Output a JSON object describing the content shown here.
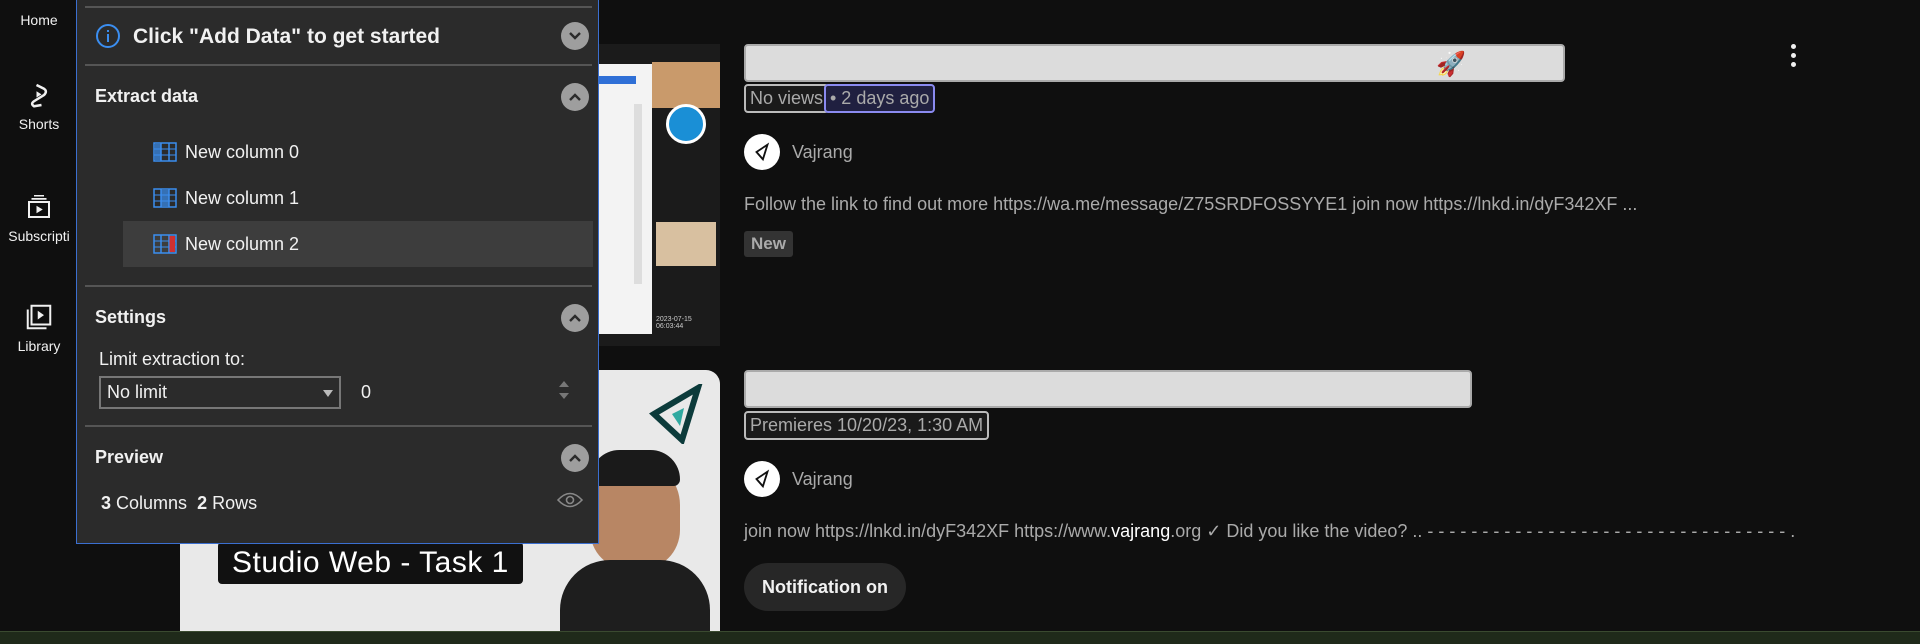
{
  "guide": {
    "items": [
      {
        "label": "Home",
        "icon": "home-icon"
      },
      {
        "label": "Shorts",
        "icon": "shorts-icon"
      },
      {
        "label": "Subscripti",
        "icon": "subscriptions-icon"
      },
      {
        "label": "Library",
        "icon": "library-icon"
      }
    ]
  },
  "panel": {
    "banner": "Click \"Add Data\" to get started",
    "extract_heading": "Extract data",
    "columns": [
      "New column 0",
      "New column 1",
      "New column 2"
    ],
    "settings_heading": "Settings",
    "limit_label": "Limit extraction to:",
    "limit_select": "No limit",
    "limit_value": "0",
    "preview_heading": "Preview",
    "preview_columns_count": "3",
    "preview_columns_label": "Columns",
    "preview_rows_count": "2",
    "preview_rows_label": "Rows"
  },
  "videos": [
    {
      "views": "No views",
      "age": "• 2 days ago",
      "channel": "Vajrang",
      "description": "Follow the link to find out more https://wa.me/message/Z75SRDFOSSYYE1 join now https://lnkd.in/dyF342XF ...",
      "badge": "New",
      "title_emoji": "🚀",
      "thumb_timestamp": "2023-07-15 06:03:44"
    },
    {
      "meta": "Premieres 10/20/23, 1:30 AM",
      "channel": "Vajrang",
      "description_pre": "join now https://lnkd.in/dyF342XF https://www.",
      "description_bold": "vajrang",
      "description_post": ".org ✓ Did you like the video? .. - - - - - - - - - - - - - - - - - - - - - - - - - - - - - - - - - .",
      "thumb_title": "Studio Web - Task 1",
      "button": "Notification on"
    }
  ],
  "colors": {
    "background": "#0f0f0f",
    "panel": "#2b2b2b",
    "panel_border": "#3b6fd0",
    "info_accent": "#3b8ef0",
    "column_icon_red": "#d03030"
  }
}
